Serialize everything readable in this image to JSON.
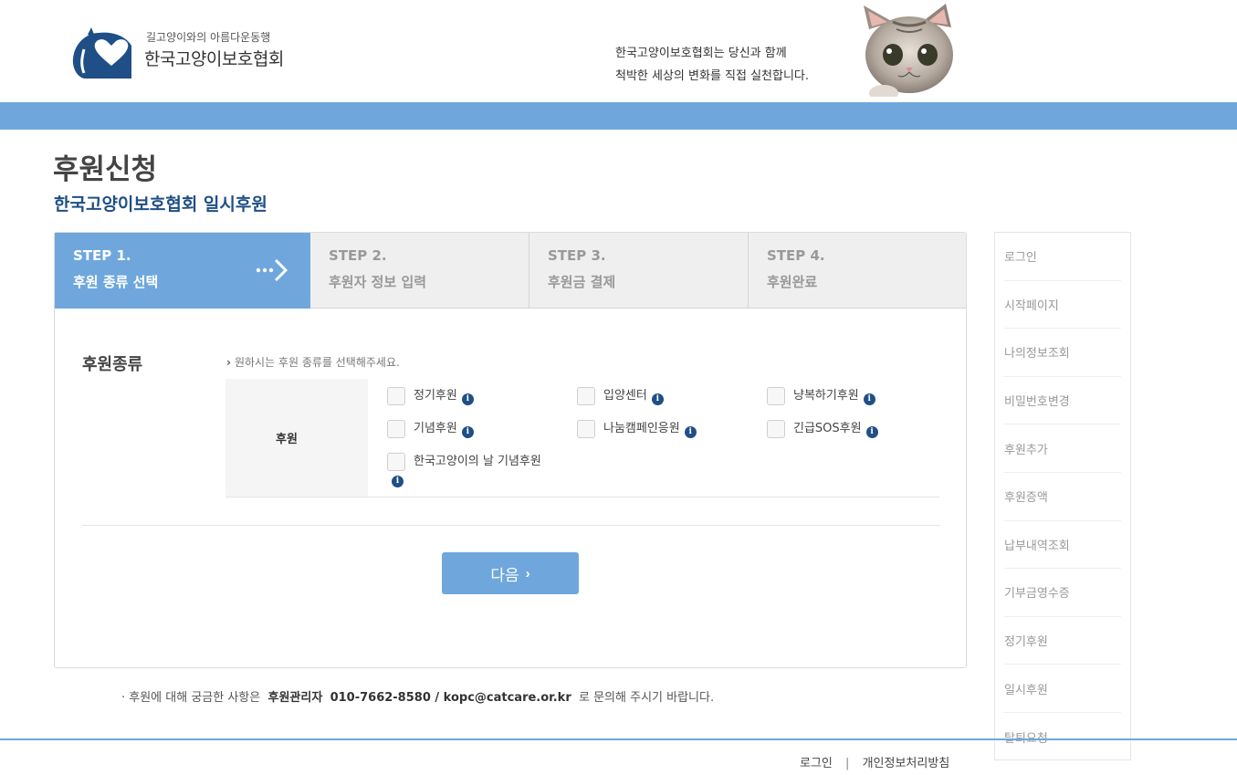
{
  "header": {
    "logo_sub": "길고양이와의 아름다운동행",
    "logo_main": "한국고양이보호협회",
    "slogan_line1": "한국고양이보호협회는  당신과 함께",
    "slogan_line2": "척박한 세상의 변화를 직접 실천합니다."
  },
  "page": {
    "title": "후원신청",
    "subtitle": "한국고양이보호협회 일시후원"
  },
  "steps": [
    {
      "num": "STEP 1.",
      "label": "후원 종류 선택",
      "active": true
    },
    {
      "num": "STEP 2.",
      "label": "후원자 정보 입력",
      "active": false
    },
    {
      "num": "STEP 3.",
      "label": "후원금 결제",
      "active": false
    },
    {
      "num": "STEP 4.",
      "label": "후원완료",
      "active": false
    }
  ],
  "form": {
    "section_label": "후원종류",
    "hint": "원하시는 후원 종류를 선택해주세요.",
    "row_header": "후원",
    "options": [
      {
        "label": "정기후원",
        "checked": false
      },
      {
        "label": "입양센터",
        "checked": false
      },
      {
        "label": "냥복하기후원",
        "checked": false
      },
      {
        "label": "기념후원",
        "checked": false
      },
      {
        "label": "나눔캠페인응원",
        "checked": false
      },
      {
        "label": "긴급SOS후원",
        "checked": false
      },
      {
        "label": "한국고양이의 날 기념후원",
        "checked": false
      }
    ],
    "info_glyph": "i",
    "next_label": "다음"
  },
  "contact": {
    "prefix": "· 후원에 대해 궁금한 사항은",
    "manager": "후원관리자",
    "details": "010-7662-8580 / kopc@catcare.or.kr",
    "suffix": "로 문의해 주시기 바랍니다."
  },
  "sidebar": {
    "items": [
      "로그인",
      "시작페이지",
      "나의정보조회",
      "비밀번호변경",
      "후원추가",
      "후원증액",
      "납부내역조회",
      "기부금영수증",
      "정기후원",
      "일시후원",
      "탈퇴요청"
    ]
  },
  "footer": {
    "links": [
      "로그인",
      "개인정보처리방침"
    ],
    "separator": "|"
  },
  "colors": {
    "accent": "#6fa7dc",
    "brand_navy": "#1f4f86"
  }
}
